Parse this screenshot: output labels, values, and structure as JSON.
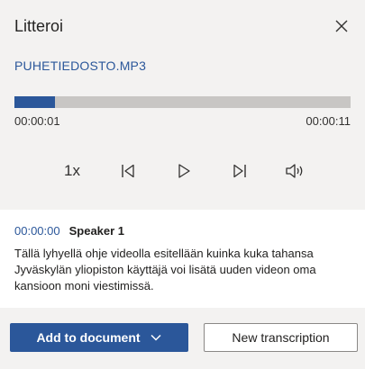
{
  "header": {
    "title": "Litteroi"
  },
  "file": {
    "name": "PUHETIEDOSTO.MP3"
  },
  "player": {
    "progress_percent": 12,
    "current_time": "00:00:01",
    "total_time": "00:00:11",
    "speed": "1x"
  },
  "icons": {
    "close": "close-icon",
    "previous": "skip-previous-icon",
    "play": "play-icon",
    "next": "skip-next-icon",
    "volume": "volume-icon",
    "dropdown": "chevron-down-icon"
  },
  "transcript": {
    "segments": [
      {
        "timestamp": "00:00:00",
        "speaker": "Speaker 1",
        "text": "Tällä lyhyellä ohje videolla esitellään kuinka kuka tahansa Jyväskylän yliopiston käyttäjä voi lisätä uuden videon oma kansioon moni viestimissä."
      }
    ]
  },
  "footer": {
    "add_label": "Add to document",
    "new_label": "New transcription"
  },
  "colors": {
    "accent": "#2b579a",
    "background": "#f3f2f1",
    "track": "#c8c6c4"
  }
}
